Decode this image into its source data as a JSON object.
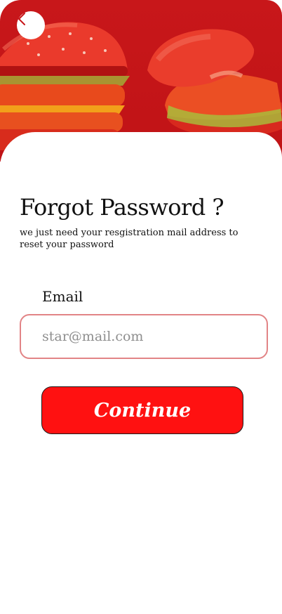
{
  "header": {
    "back_icon": "chevron-left-icon",
    "background_color": "#c8171a"
  },
  "form": {
    "title": "Forgot Password ?",
    "subtitle": "we just need your resgistration mail address to reset your password",
    "email_label": "Email",
    "email_placeholder": "star@mail.com",
    "email_value": "",
    "continue_label": "Continue"
  },
  "colors": {
    "accent": "#ff1111",
    "field_border": "#e28486"
  }
}
